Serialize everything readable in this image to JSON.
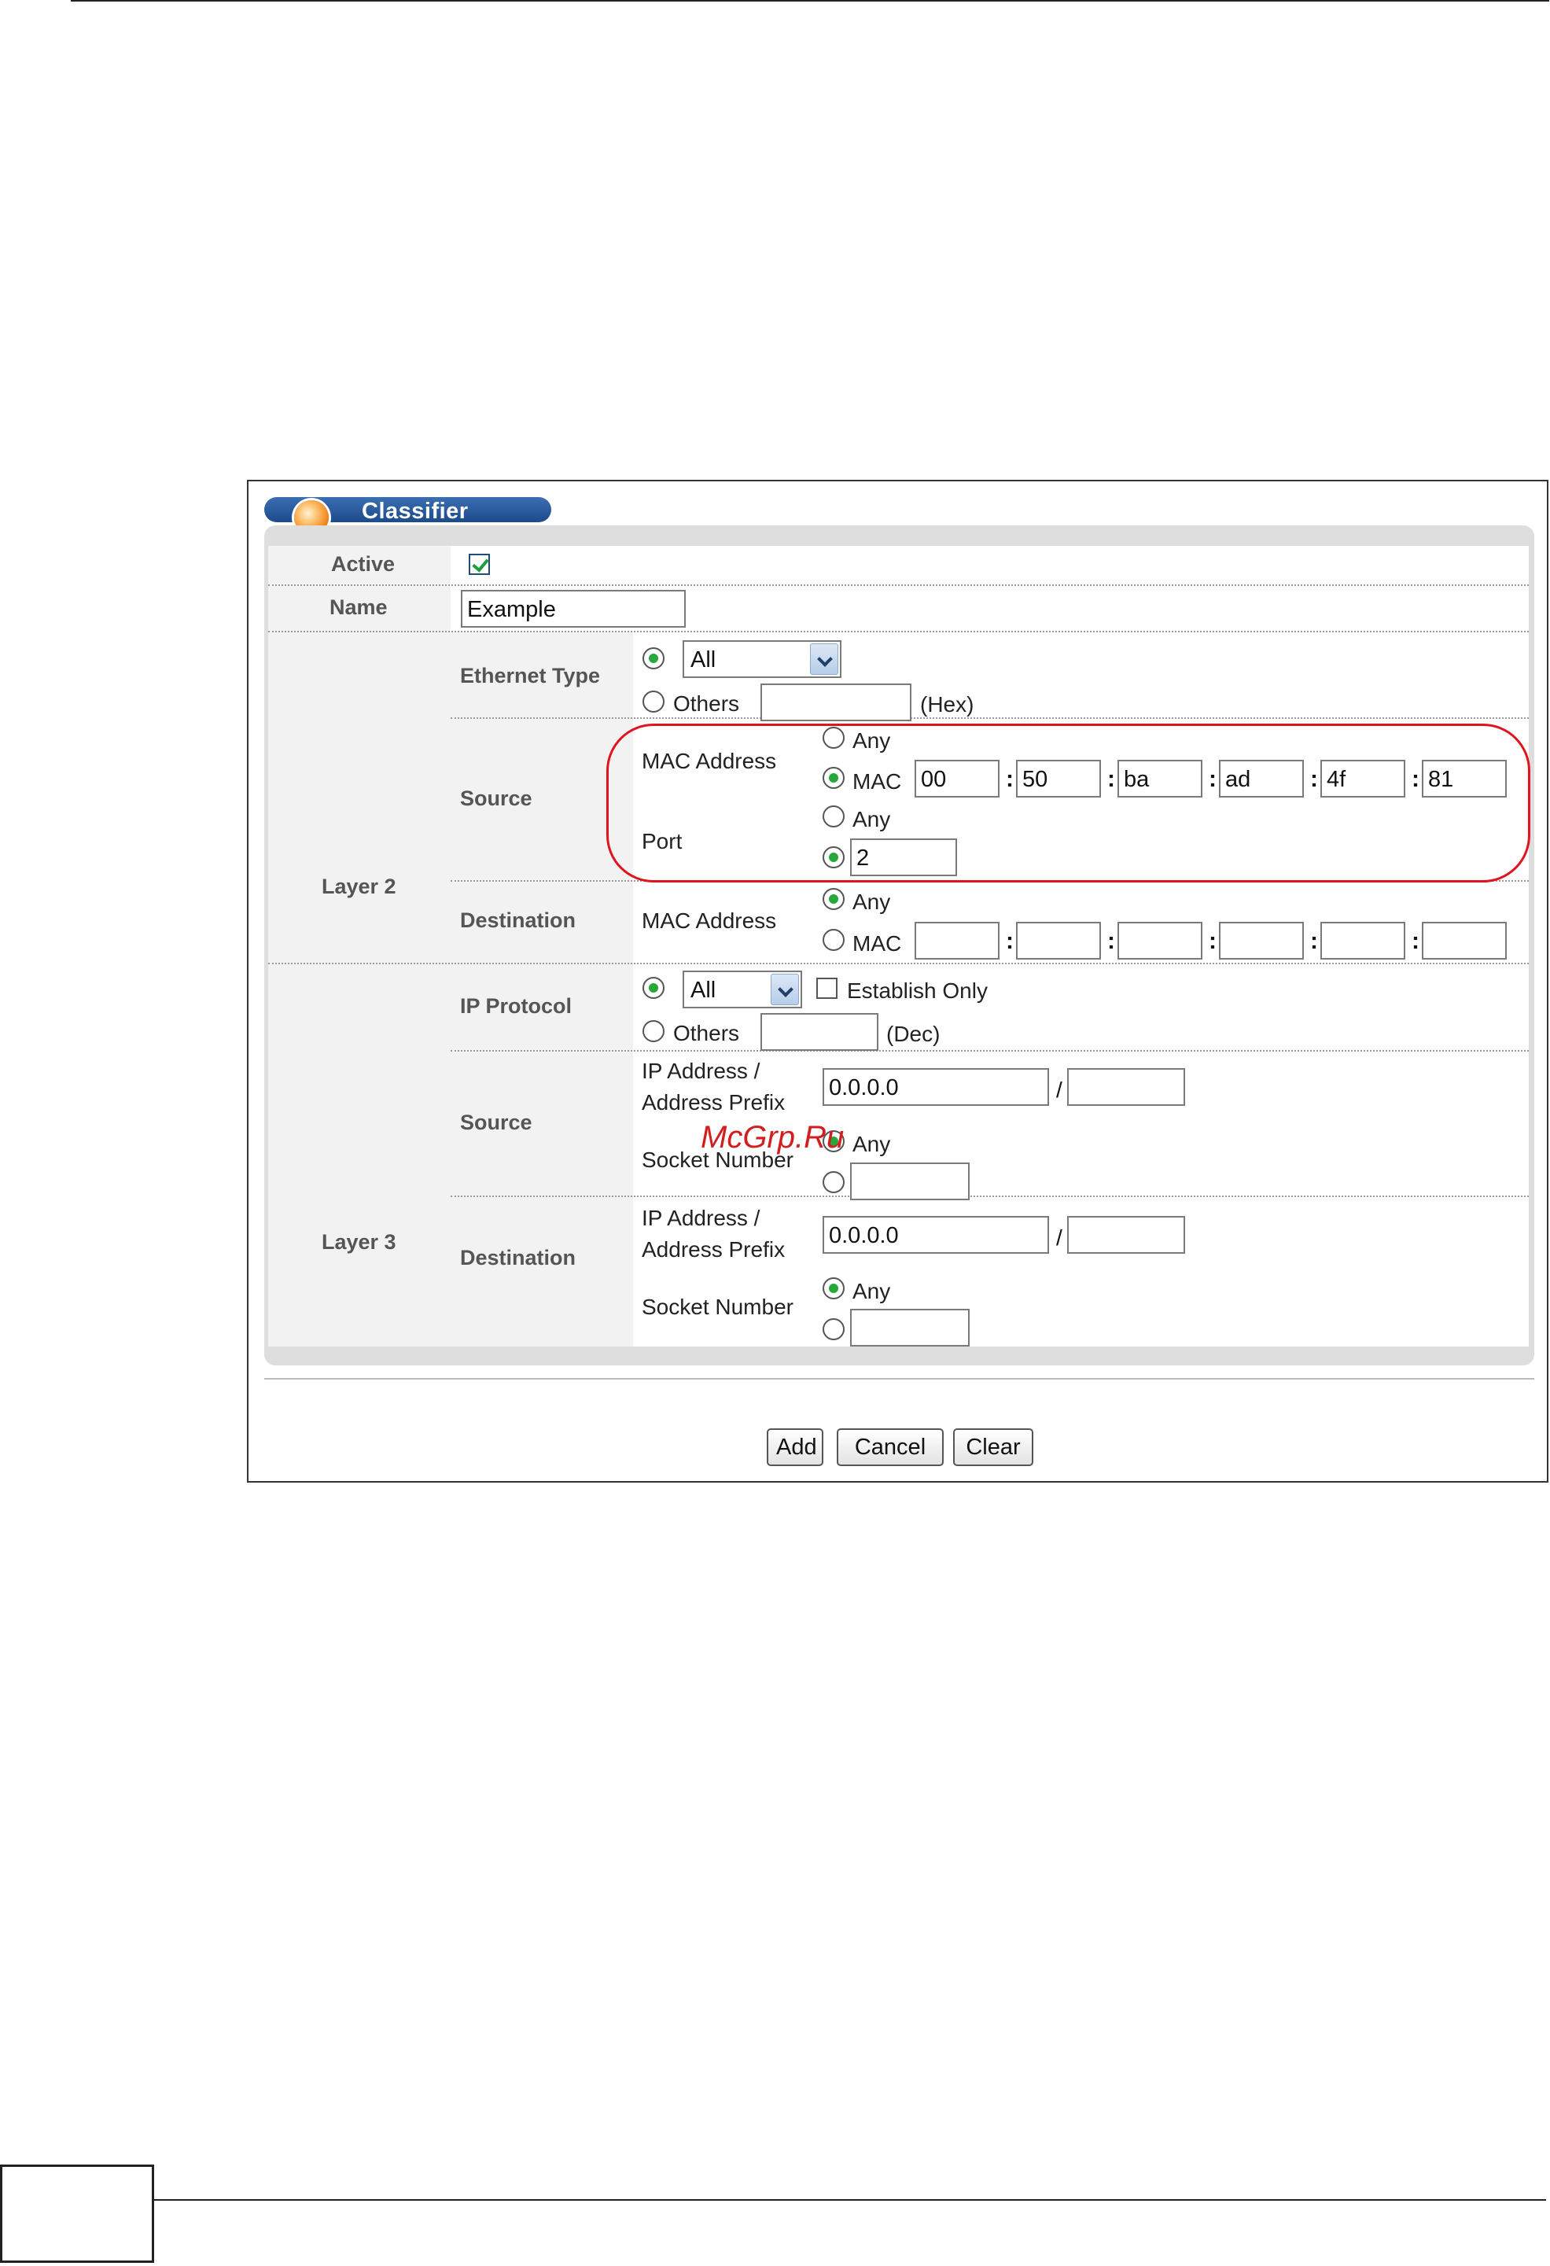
{
  "window": {
    "title": "Classifier"
  },
  "form": {
    "active_label": "Active",
    "active_checked": true,
    "name_label": "Name",
    "name_value": "Example",
    "layer2": {
      "label": "Layer 2",
      "ethernet_type": {
        "label": "Ethernet Type",
        "selected": "All",
        "others_label": "Others",
        "others_value": "",
        "unit": "(Hex)"
      },
      "source": {
        "label": "Source",
        "mac_label": "MAC Address",
        "any_label": "Any",
        "mac_option_label": "MAC",
        "mac_octets": [
          "00",
          "50",
          "ba",
          "ad",
          "4f",
          "81"
        ],
        "port_label": "Port",
        "port_any_label": "Any",
        "port_value": "2"
      },
      "destination": {
        "label": "Destination",
        "mac_label": "MAC Address",
        "any_label": "Any",
        "mac_option_label": "MAC",
        "mac_octets": [
          "",
          "",
          "",
          "",
          "",
          ""
        ]
      }
    },
    "layer3": {
      "label": "Layer 3",
      "ip_protocol": {
        "label": "IP Protocol",
        "selected": "All",
        "establish_only_label": "Establish Only",
        "others_label": "Others",
        "others_value": "",
        "unit": "(Dec)"
      },
      "source": {
        "label": "Source",
        "ip_label_1": "IP Address /",
        "ip_label_2": "Address Prefix",
        "ip_value": "0.0.0.0",
        "prefix_value": "",
        "socket_label": "Socket Number",
        "any_label": "Any",
        "socket_value": ""
      },
      "destination": {
        "label": "Destination",
        "ip_label_1": "IP Address /",
        "ip_label_2": "Address Prefix",
        "ip_value": "0.0.0.0",
        "prefix_value": "",
        "socket_label": "Socket Number",
        "any_label": "Any",
        "socket_value": ""
      }
    }
  },
  "buttons": {
    "add": "Add",
    "cancel": "Cancel",
    "clear": "Clear"
  },
  "watermark": "McGrp.Ru",
  "colors": {
    "accent": "#1d4a8a",
    "highlight": "#e0141e",
    "radio_on": "#27a83a"
  }
}
